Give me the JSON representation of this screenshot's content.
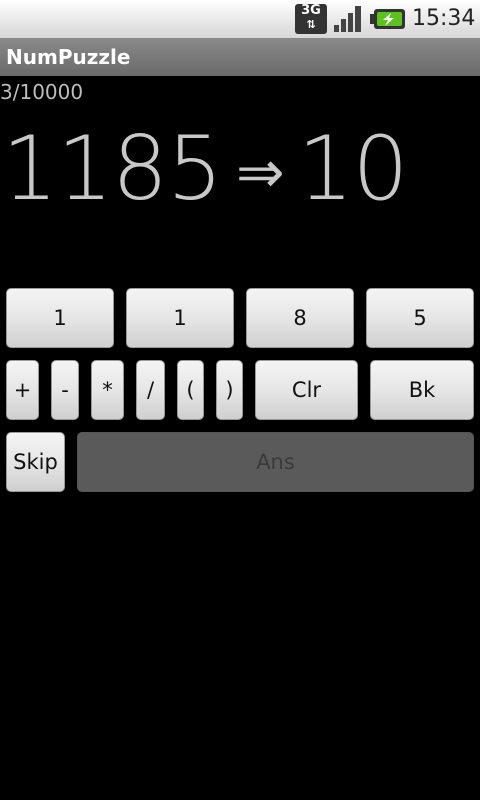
{
  "status_bar": {
    "network_label": "3G",
    "network_arrows": "⇅",
    "time": "15:34"
  },
  "app": {
    "title": "NumPuzzle"
  },
  "puzzle": {
    "progress": "3/10000",
    "digits": "1185",
    "arrow": "⇒",
    "target": "10"
  },
  "keypad": {
    "digits": [
      "1",
      "1",
      "8",
      "5"
    ],
    "ops": [
      "+",
      "-",
      "*",
      "/",
      "(",
      ")"
    ],
    "clear_label": "Clr",
    "back_label": "Bk",
    "skip_label": "Skip",
    "answer_label": "Ans"
  },
  "colors": {
    "background": "#000000",
    "puzzle_text": "#c8c8c8",
    "title_bar": "#7a7a7a"
  }
}
